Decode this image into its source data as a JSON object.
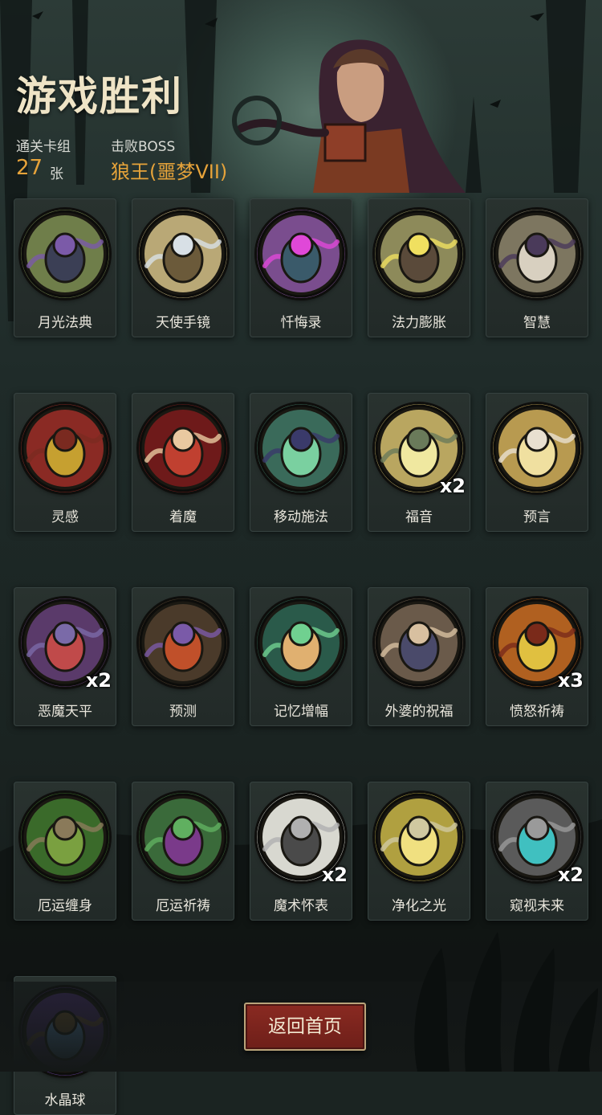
{
  "title": "游戏胜利",
  "stats": {
    "deck_label": "通关卡组",
    "deck_count": "27",
    "deck_unit": "张",
    "boss_label": "击败BOSS",
    "boss_name": "狼王(噩梦VII)"
  },
  "colors": {
    "accent": "#e6a33a",
    "title": "#efe4c6",
    "button": "#7a241d",
    "background": "#1f2b29"
  },
  "cards": [
    {
      "name": "月光法典",
      "icon": "moon-grimoire-icon",
      "count": ""
    },
    {
      "name": "天使手镜",
      "icon": "angel-mirror-icon",
      "count": ""
    },
    {
      "name": "忏悔录",
      "icon": "confession-book-icon",
      "count": ""
    },
    {
      "name": "法力膨胀",
      "icon": "mana-surge-icon",
      "count": ""
    },
    {
      "name": "智慧",
      "icon": "wisdom-sage-icon",
      "count": ""
    },
    {
      "name": "灵感",
      "icon": "inspiration-skull-icon",
      "count": ""
    },
    {
      "name": "着魔",
      "icon": "possessed-icon",
      "count": ""
    },
    {
      "name": "移动施法",
      "icon": "moving-cast-witch-icon",
      "count": ""
    },
    {
      "name": "福音",
      "icon": "gospel-cross-icon",
      "count": "x2"
    },
    {
      "name": "预言",
      "icon": "prophecy-elder-icon",
      "count": ""
    },
    {
      "name": "恶魔天平",
      "icon": "demon-scale-icon",
      "count": "x2"
    },
    {
      "name": "预测",
      "icon": "prediction-witch-icon",
      "count": ""
    },
    {
      "name": "记忆增幅",
      "icon": "memory-brain-icon",
      "count": ""
    },
    {
      "name": "外婆的祝福",
      "icon": "grandma-blessing-icon",
      "count": ""
    },
    {
      "name": "愤怒祈祷",
      "icon": "rage-prayer-icon",
      "count": "x3"
    },
    {
      "name": "厄运缠身",
      "icon": "doom-skull-icon",
      "count": ""
    },
    {
      "name": "厄运祈祷",
      "icon": "doom-prayer-icon",
      "count": ""
    },
    {
      "name": "魔术怀表",
      "icon": "pocket-watch-icon",
      "count": "x2"
    },
    {
      "name": "净化之光",
      "icon": "purifying-light-icon",
      "count": ""
    },
    {
      "name": "窥视未来",
      "icon": "future-staff-icon",
      "count": "x2"
    },
    {
      "name": "水晶球",
      "icon": "crystal-ball-icon",
      "count": ""
    }
  ],
  "footer": {
    "home_label": "返回首页"
  }
}
